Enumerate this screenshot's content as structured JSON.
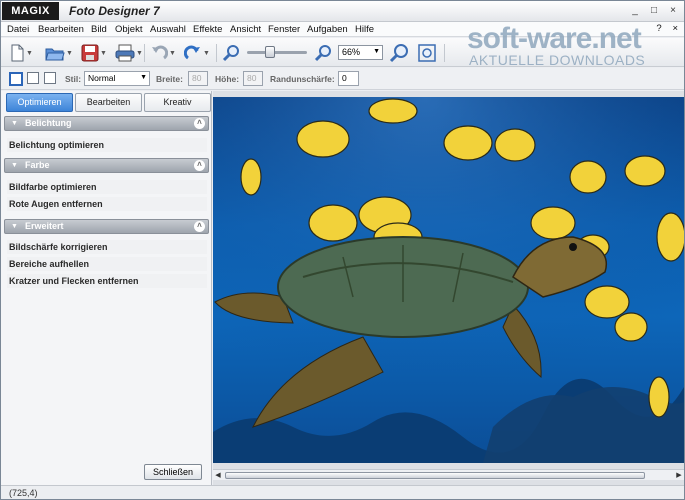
{
  "app": {
    "brand": "MAGIX",
    "title": "Foto Designer 7",
    "window_controls": [
      "_",
      "□",
      "×"
    ]
  },
  "menu": {
    "items": [
      "Datei",
      "Bearbeiten",
      "Bild",
      "Objekt",
      "Auswahl",
      "Effekte",
      "Ansicht",
      "Fenster",
      "Aufgaben",
      "Hilfe"
    ],
    "right_controls": [
      "?",
      "×"
    ]
  },
  "toolbar": {
    "zoom_value": "66%",
    "icons": [
      "new-document-icon",
      "open-folder-icon",
      "save-icon",
      "print-icon",
      "undo-icon",
      "redo-icon",
      "zoom-out-icon",
      "zoom-in-icon",
      "zoom-100-icon",
      "zoom-fit-icon"
    ]
  },
  "watermark": {
    "line1": "soft-ware.net",
    "line2": "AKTUELLE DOWNLOADS"
  },
  "options": {
    "stil_label": "Stil:",
    "stil_value": "Normal",
    "breite_label": "Breite:",
    "breite_value": "80",
    "hoehe_label": "Höhe:",
    "hoehe_value": "80",
    "rand_label": "Randunschärfe:",
    "rand_value": "0"
  },
  "panel": {
    "tabs": [
      {
        "label": "Optimieren",
        "active": true
      },
      {
        "label": "Bearbeiten",
        "active": false
      },
      {
        "label": "Kreativ",
        "active": false
      }
    ],
    "sections": [
      {
        "title": "Belichtung",
        "items": [
          "Belichtung optimieren"
        ]
      },
      {
        "title": "Farbe",
        "items": [
          "Bildfarbe optimieren",
          "Rote Augen entfernen"
        ]
      },
      {
        "title": "Erweitert",
        "items": [
          "Bildschärfe korrigieren",
          "Bereiche aufhellen",
          "Kratzer und Flecken entfernen"
        ]
      }
    ],
    "close_label": "Schließen"
  },
  "status": {
    "coords": "(725,4)"
  },
  "colors": {
    "accent": "#3d84d8",
    "water": "#0c5fb0",
    "fish_yellow": "#f2d23a"
  }
}
